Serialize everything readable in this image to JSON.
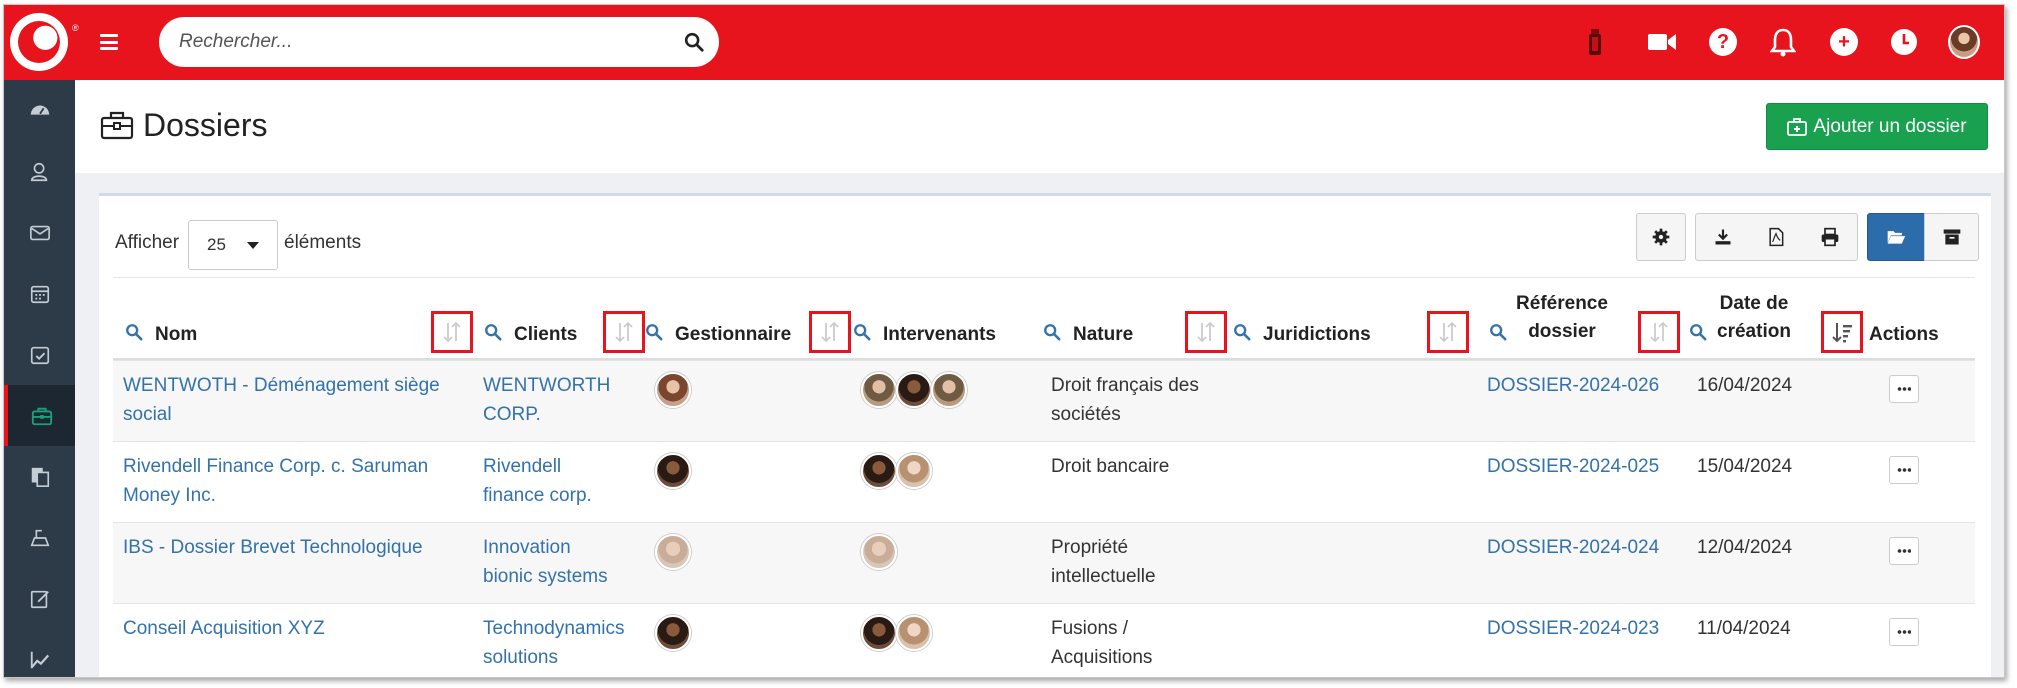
{
  "topbar": {
    "search_placeholder": "Rechercher...",
    "icons": [
      "logo-icon",
      "hamburger-icon",
      "search-icon",
      "timer-icon",
      "video-icon",
      "help-icon",
      "bell-icon",
      "plus-icon",
      "clock-icon",
      "avatar"
    ],
    "brand_color": "#e8141d"
  },
  "sidebar": {
    "items": [
      {
        "name": "dashboard-icon",
        "active": false
      },
      {
        "name": "contacts-icon",
        "active": false
      },
      {
        "name": "mail-icon",
        "active": false
      },
      {
        "name": "calendar-icon",
        "active": false
      },
      {
        "name": "tasks-icon",
        "active": false
      },
      {
        "name": "briefcase-icon",
        "active": true
      },
      {
        "name": "documents-icon",
        "active": false
      },
      {
        "name": "billing-icon",
        "active": false
      },
      {
        "name": "notes-icon",
        "active": false
      },
      {
        "name": "stats-icon",
        "active": false
      }
    ]
  },
  "page": {
    "title": "Dossiers",
    "add_button": "Ajouter un dossier",
    "add_button_color": "#1aa14f"
  },
  "listing": {
    "show_label": "Afficher",
    "page_size": "25",
    "elements_label": "éléments",
    "toolbar": [
      "gear-icon",
      "download-icon",
      "pdf-icon",
      "print-icon",
      "folder-open-icon",
      "archive-icon"
    ]
  },
  "table": {
    "columns": {
      "nom": "Nom",
      "clients": "Clients",
      "gestionnaire": "Gestionnaire",
      "intervenants": "Intervenants",
      "nature": "Nature",
      "juridictions": "Juridictions",
      "reference_l1": "Référence",
      "reference_l2": "dossier",
      "date_l1": "Date de",
      "date_l2": "création",
      "actions": "Actions"
    },
    "rows": [
      {
        "nom_l1": "WENTWOTH - Déménagement siège",
        "nom_l2": "social",
        "client_l1": "WENTWORTH",
        "client_l2": "CORP.",
        "nature_l1": "Droit français des",
        "nature_l2": "sociétés",
        "reference": "DOSSIER-2024-026",
        "date": "16/04/2024"
      },
      {
        "nom_l1": "Rivendell Finance Corp. c. Saruman",
        "nom_l2": "Money Inc.",
        "client_l1": "Rivendell",
        "client_l2": "finance corp.",
        "nature_l1": "Droit bancaire",
        "nature_l2": "",
        "reference": "DOSSIER-2024-025",
        "date": "15/04/2024"
      },
      {
        "nom_l1": "IBS - Dossier Brevet Technologique",
        "nom_l2": "",
        "client_l1": "Innovation",
        "client_l2": "bionic systems",
        "nature_l1": "Propriété",
        "nature_l2": "intellectuelle",
        "reference": "DOSSIER-2024-024",
        "date": "12/04/2024"
      },
      {
        "nom_l1": "Conseil Acquisition XYZ",
        "nom_l2": "",
        "client_l1": "Technodynamics",
        "client_l2": "solutions",
        "nature_l1": "Fusions /",
        "nature_l2": "Acquisitions",
        "reference": "DOSSIER-2024-023",
        "date": "11/04/2024"
      }
    ]
  }
}
